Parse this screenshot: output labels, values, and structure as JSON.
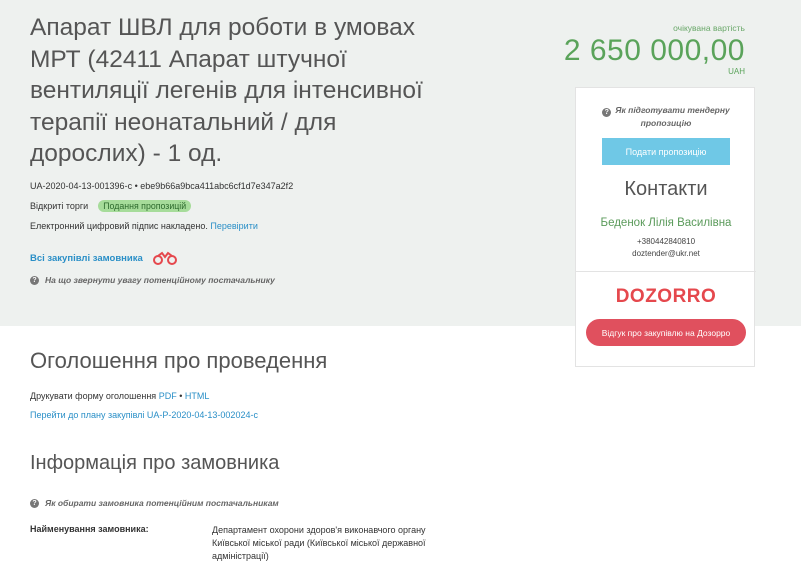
{
  "tender": {
    "title": "Апарат ШВЛ для роботи в умовах МРТ (42411 Апарат штучної вентиляції легенів для інтенсивної терапії неонатальний / для дорослих) - 1 од.",
    "id_line": "UA-2020-04-13-001396-c • ebe9b66a9bca411abc6cf1d7e347a2f2",
    "procedure_type": "Відкриті торги",
    "status_badge": "Подання пропозицій",
    "signature_text": "Електронний цифровий підпис накладено.",
    "verify_link": "Перевірити",
    "all_procurements_link": "Всі закупівлі замовника",
    "supplier_hint": "На що звернути увагу потенційному постачальнику"
  },
  "expected": {
    "label": "очікувана вартість",
    "value": "2 650 000,00",
    "currency": "UAH"
  },
  "sidebar": {
    "tender_hint": "Як підготувати тендерну пропозицію",
    "offer_button": "Подати пропозицію",
    "contacts_title": "Контакти",
    "contact_name": "Беденок Лілія Василівна",
    "contact_phone": "+380442840810",
    "contact_email": "doztender@ukr.net",
    "dozorro_logo": "DOZORRO",
    "dozorro_button": "Відгук про закупівлю на Дозорро"
  },
  "announcement": {
    "heading": "Оголошення про проведення",
    "print_label": "Друкувати форму оголошення",
    "pdf_link": "PDF",
    "separator": "•",
    "html_link": "HTML",
    "plan_link": "Перейти до плану закупівлі UA-P-2020-04-13-002024-c"
  },
  "customer": {
    "heading": "Інформація про замовника",
    "hint": "Як обирати замовника потенційним постачальникам",
    "name_label": "Найменування замовника:",
    "name_value": "Департамент охорони здоров'я виконавчого органу Київської міської ради (Київської міської державної адміністрації)"
  },
  "colors": {
    "band": "#eef1ef",
    "accent_green": "#5aa35a",
    "link_blue": "#2a8fc7",
    "offer_button": "#6fc8e6",
    "dozorro_red": "#e0505e"
  }
}
